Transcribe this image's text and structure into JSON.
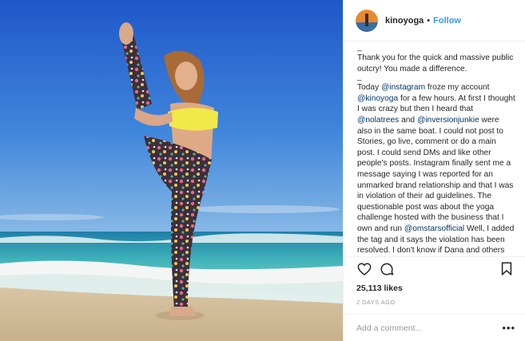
{
  "post": {
    "username": "kinoyoga",
    "separator": "•",
    "follow_label": "Follow",
    "caption": {
      "sep1": "_",
      "para1": "Thank you for the quick and massive public outcry! You made a difference.",
      "sep2": "_",
      "p2_a": "Today ",
      "m_instagram": "@instagram",
      "p2_b": " froze my account ",
      "m_kinoyoga": "@kinoyoga",
      "p2_c": " for a few hours. At first I thought I was crazy but then I heard that ",
      "m_nolatrees": "@nolatrees",
      "p2_d": " and ",
      "m_inversionjunkie": "@inversionjunkie",
      "p2_e": " were also in the same boat. I could not post to Stories, go live, comment or do a main post. I could send DMs and like other people's posts. Instagram finally sent me a message saying I was reported for an unmarked brand relationship and that I was in violation of their ad guidelines. The questionable post was about the yoga challenge hosted with the business that I own and run ",
      "m_omstarsofficial": "@omstarsofficial",
      "p2_f": " Well, I added the tag and it says the violation has been resolved. I don't know if Dana and others were similarly reported today."
    },
    "likes": "25,113 likes",
    "time_ago": "2 DAYS AGO",
    "comment_placeholder": "Add a comment...",
    "more_label": "•••",
    "icons": {
      "like": "heart-icon",
      "comment": "comment-icon",
      "save": "bookmark-icon"
    },
    "colors": {
      "link": "#3897f0",
      "mention": "#003569",
      "muted": "#999999",
      "text": "#262626"
    }
  }
}
